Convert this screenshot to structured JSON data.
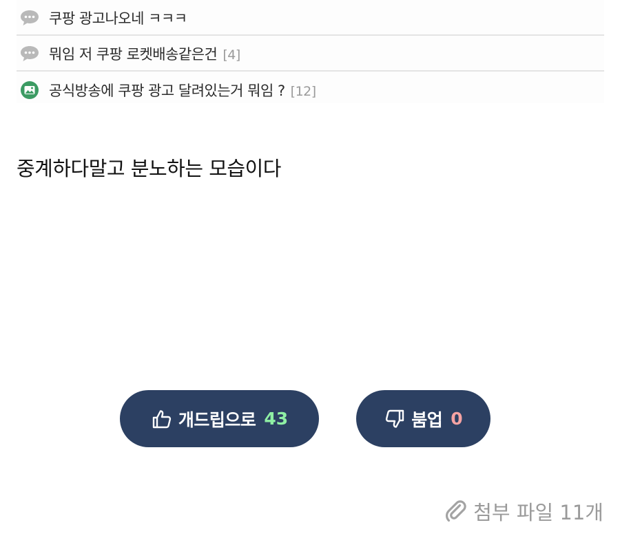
{
  "thread_list": {
    "rows": [
      {
        "icon": "speech-bubble-icon",
        "title": "쿠팡 광고나오네 ㅋㅋㅋ",
        "count": ""
      },
      {
        "icon": "speech-bubble-icon",
        "title": "뭐임 저 쿠팡 로켓배송같은건",
        "count": "[4]"
      },
      {
        "icon": "image-post-icon",
        "title": "공식방송에 쿠팡 광고 달려있는거 뭐임 ?",
        "count": "[12]"
      }
    ]
  },
  "post": {
    "body": "중계하다말고 분노하는 모습이다"
  },
  "votes": {
    "up": {
      "icon": "thumbs-up-icon",
      "label": "개드립으로",
      "count": "43",
      "count_color": "#8ff0a4"
    },
    "down": {
      "icon": "thumbs-down-icon",
      "label": "붐업",
      "count": "0",
      "count_color": "#f5a3a3"
    }
  },
  "attachment": {
    "icon": "paperclip-icon",
    "label": "첨부 파일 11개"
  },
  "colors": {
    "button_bg": "#2c4062",
    "attachment_text": "#9a9a9a",
    "divider": "#e4e4e4"
  }
}
